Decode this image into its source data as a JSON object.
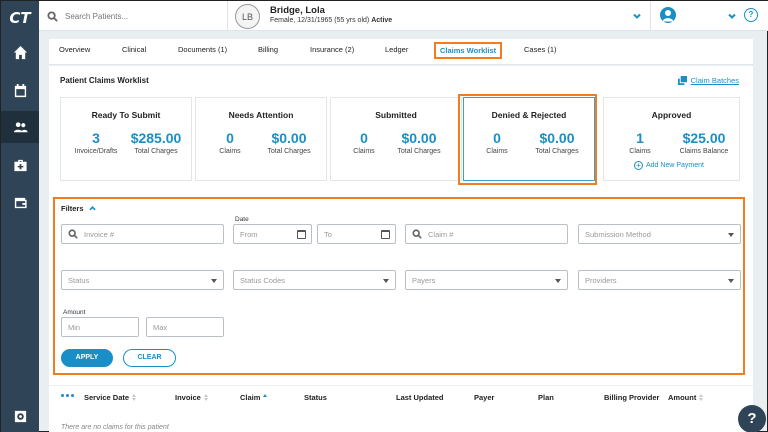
{
  "app": {
    "logo": "CT"
  },
  "header": {
    "search_placeholder": "Search Patients...",
    "patient_initials": "LB",
    "patient_name": "Bridge, Lola",
    "patient_info": "Female, 12/31/1965 (55 yrs old)",
    "patient_status": "Active",
    "help_label": "?"
  },
  "tabs": [
    {
      "label": "Overview"
    },
    {
      "label": "Clinical"
    },
    {
      "label": "Documents (1)"
    },
    {
      "label": "Billing"
    },
    {
      "label": "Insurance (2)"
    },
    {
      "label": "Ledger"
    },
    {
      "label": "Claims Worklist"
    },
    {
      "label": "Cases (1)"
    }
  ],
  "worklist": {
    "title": "Patient Claims Worklist",
    "batches_label": "Claim Batches"
  },
  "summary_cards": [
    {
      "title": "Ready To Submit",
      "left_value": "3",
      "left_label": "Invoice/Drafts",
      "right_value": "$285.00",
      "right_label": "Total Charges"
    },
    {
      "title": "Needs Attention",
      "left_value": "0",
      "left_label": "Claims",
      "right_value": "$0.00",
      "right_label": "Total Charges"
    },
    {
      "title": "Submitted",
      "left_value": "0",
      "left_label": "Claims",
      "right_value": "$0.00",
      "right_label": "Total Charges"
    },
    {
      "title": "Denied & Rejected",
      "left_value": "0",
      "left_label": "Claims",
      "right_value": "$0.00",
      "right_label": "Total Charges"
    },
    {
      "title": "Approved",
      "left_value": "1",
      "left_label": "Claims",
      "right_value": "$25.00",
      "right_label": "Claims Balance",
      "action": "Add New Payment"
    }
  ],
  "filters": {
    "label": "Filters",
    "invoice_placeholder": "Invoice #",
    "date_label": "Date",
    "from_placeholder": "From",
    "to_placeholder": "To",
    "claim_placeholder": "Claim #",
    "submission_method_placeholder": "Submission Method",
    "status_placeholder": "Status",
    "status_codes_placeholder": "Status Codes",
    "payers_placeholder": "Payers",
    "providers_placeholder": "Providers",
    "amount_label": "Amount",
    "min_placeholder": "Min",
    "max_placeholder": "Max",
    "apply_label": "APPLY",
    "clear_label": "CLEAR"
  },
  "table": {
    "columns": [
      "Service Date",
      "Invoice",
      "Claim",
      "Status",
      "Last Updated",
      "Payer",
      "Plan",
      "Billing Provider",
      "Amount"
    ],
    "empty_message": "There are no claims for this patient"
  },
  "colors": {
    "accent": "#1a8fc7",
    "highlight": "#f47c20",
    "sidebar": "#2f4456"
  }
}
